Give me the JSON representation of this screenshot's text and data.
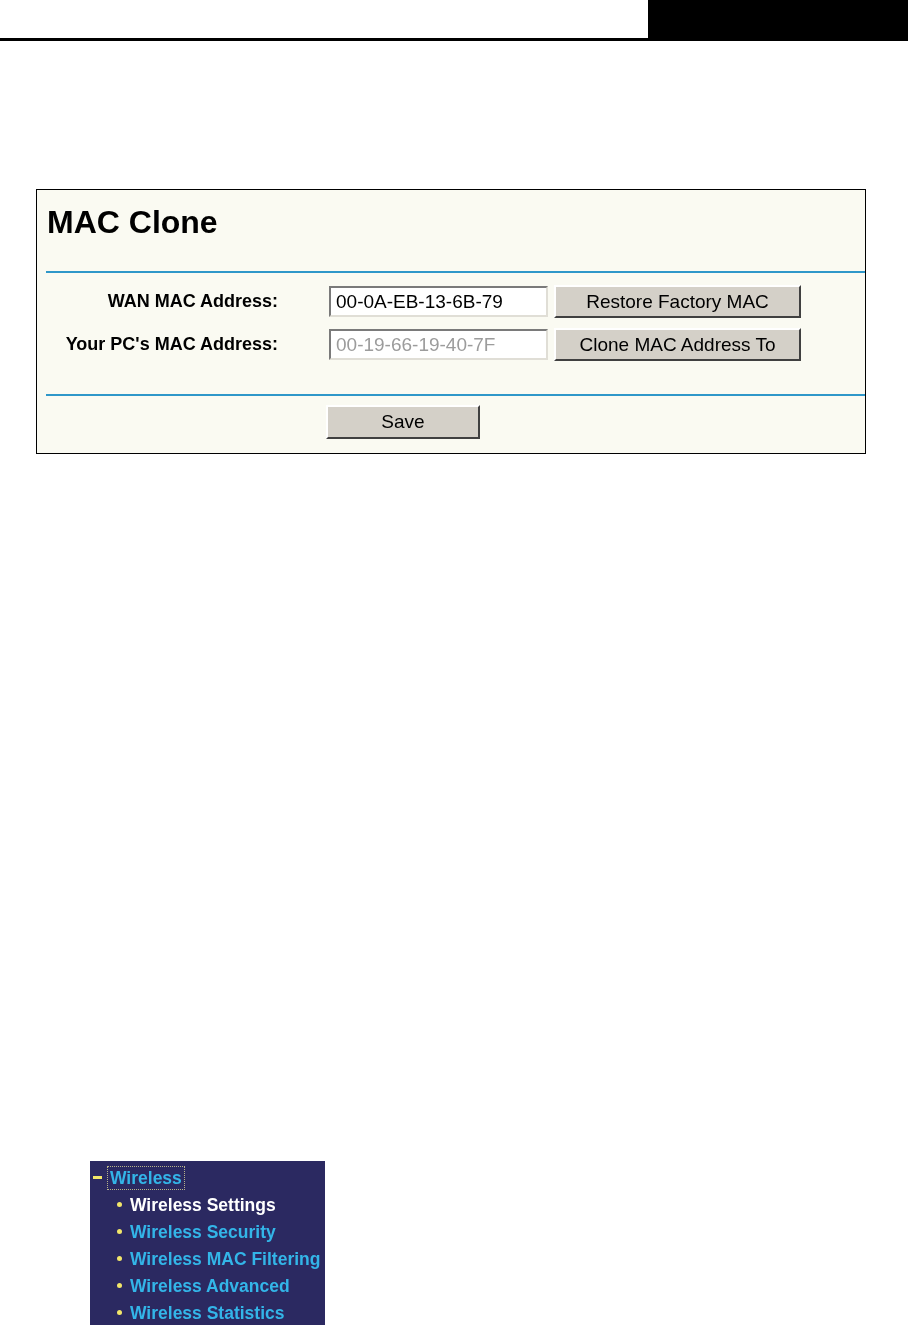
{
  "mac_clone": {
    "title": "MAC Clone",
    "rows": [
      {
        "label": "WAN MAC Address:",
        "value": "00-0A-EB-13-6B-79",
        "disabled": false,
        "button": "Restore Factory MAC"
      },
      {
        "label": "Your PC's MAC Address:",
        "value": "00-19-66-19-40-7F",
        "disabled": true,
        "button": "Clone MAC Address To"
      }
    ],
    "save_button": "Save"
  },
  "sidebar": {
    "items": [
      {
        "label": "Wireless",
        "expanded": true,
        "focused": true,
        "children": [
          {
            "label": "Wireless Settings",
            "selected": true
          },
          {
            "label": "Wireless Security",
            "selected": false
          },
          {
            "label": "Wireless MAC Filtering",
            "selected": false
          },
          {
            "label": "Wireless Advanced",
            "selected": false
          },
          {
            "label": "Wireless Statistics",
            "selected": false
          }
        ]
      }
    ]
  }
}
